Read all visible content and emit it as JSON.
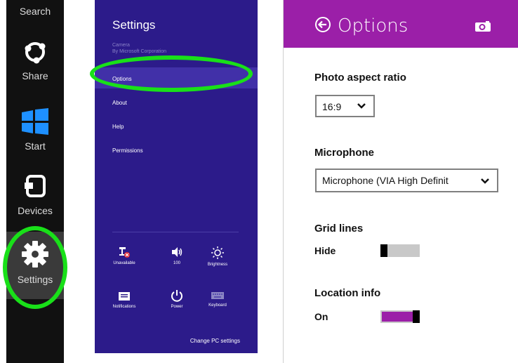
{
  "charms": {
    "search_label": "Search",
    "share_label": "Share",
    "start_label": "Start",
    "devices_label": "Devices",
    "settings_label": "Settings"
  },
  "settings_pane": {
    "title": "Settings",
    "app_name": "Camera",
    "app_publisher": "By Microsoft Corporation",
    "menu": [
      "Options",
      "About",
      "Help",
      "Permissions"
    ],
    "quick_settings": [
      {
        "label": "Unavailable",
        "icon": "network-unavailable-icon"
      },
      {
        "label": "100",
        "icon": "volume-icon"
      },
      {
        "label": "Brightness",
        "icon": "brightness-icon"
      },
      {
        "label": "Notifications",
        "icon": "notifications-icon"
      },
      {
        "label": "Power",
        "icon": "power-icon"
      },
      {
        "label": "Keyboard",
        "icon": "keyboard-icon"
      }
    ],
    "change_pc_settings": "Change PC settings"
  },
  "options_pane": {
    "title": "Options",
    "photo_aspect_ratio": {
      "label": "Photo aspect ratio",
      "value": "16:9"
    },
    "microphone": {
      "label": "Microphone",
      "value": "Microphone (VIA High Definit"
    },
    "grid_lines": {
      "label": "Grid lines",
      "state": "Hide"
    },
    "location_info": {
      "label": "Location info",
      "state": "On"
    }
  },
  "colors": {
    "accent": "#9b1fa8",
    "settings_bg": "#2c1b8a",
    "highlight": "#19e019"
  }
}
